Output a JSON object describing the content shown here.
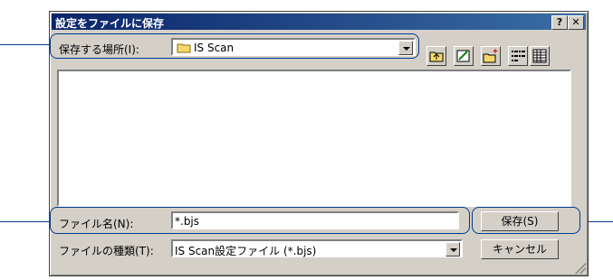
{
  "window": {
    "title": "設定をファイルに保存",
    "help_glyph": "?",
    "close_glyph": "✕"
  },
  "location": {
    "label": "保存する場所(I):",
    "value": "IS Scan"
  },
  "toolbar": {
    "icons": [
      "up-folder-icon",
      "desktop-icon",
      "new-folder-icon",
      "list-view-icon",
      "details-view-icon"
    ]
  },
  "filename": {
    "label": "ファイル名(N):",
    "value": "*.bjs"
  },
  "filetype": {
    "label": "ファイルの種類(T):",
    "value": "IS Scan設定ファイル (*.bjs)"
  },
  "buttons": {
    "save": "保存(S)",
    "cancel": "キャンセル"
  },
  "colors": {
    "titlebar": "#0a246a",
    "highlight": "#003a8c",
    "face": "#d4d0c8"
  }
}
